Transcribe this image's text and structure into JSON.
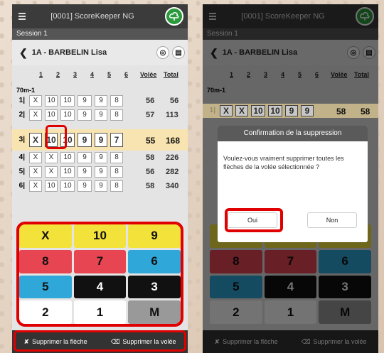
{
  "app": {
    "title": "[0001] ScoreKeeper NG",
    "session": "Session 1",
    "archer": "1A - BARBELIN Lisa",
    "distance": "70m-1"
  },
  "table_header": {
    "c1": "1",
    "c2": "2",
    "c3": "3",
    "c4": "4",
    "c5": "5",
    "c6": "6",
    "volee": "Volée",
    "total": "Total"
  },
  "ends": [
    {
      "num": "1|",
      "arrows": [
        "X",
        "10",
        "10",
        "9",
        "9",
        "8"
      ],
      "volee": "56",
      "total": "56"
    },
    {
      "num": "2|",
      "arrows": [
        "X",
        "10",
        "10",
        "9",
        "9",
        "8"
      ],
      "volee": "57",
      "total": "113"
    },
    {
      "num": "3|",
      "arrows": [
        "X",
        "10",
        "10",
        "9",
        "9",
        "7"
      ],
      "volee": "55",
      "total": "168"
    },
    {
      "num": "4|",
      "arrows": [
        "X",
        "X",
        "10",
        "9",
        "9",
        "8"
      ],
      "volee": "58",
      "total": "226"
    },
    {
      "num": "5|",
      "arrows": [
        "X",
        "X",
        "10",
        "9",
        "9",
        "8"
      ],
      "volee": "56",
      "total": "282"
    },
    {
      "num": "6|",
      "arrows": [
        "X",
        "10",
        "10",
        "9",
        "9",
        "8"
      ],
      "volee": "58",
      "total": "340"
    }
  ],
  "keypad": {
    "k1": "X",
    "k2": "10",
    "k3": "9",
    "k4": "8",
    "k5": "7",
    "k6": "6",
    "k7": "5",
    "k8": "4",
    "k9": "3",
    "k10": "2",
    "k11": "1",
    "k12": "M"
  },
  "footer": {
    "delete_arrow": "Supprimer la flèche",
    "delete_end": "Supprimer la volée"
  },
  "dialog": {
    "title": "Confirmation de la suppression",
    "message": "Voulez-vous vraiment supprimer toutes les flèches de la volée sélectionnée ?",
    "yes": "Oui",
    "no": "Non"
  },
  "right_selected_end": {
    "num": "1|",
    "arrows": [
      "X",
      "X",
      "10",
      "10",
      "9",
      "9"
    ],
    "volee": "58",
    "total": "58"
  },
  "colors": {
    "highlight": "#e10000",
    "selected_row": "#f8e4b0",
    "cloud": "#2a9a3c"
  }
}
